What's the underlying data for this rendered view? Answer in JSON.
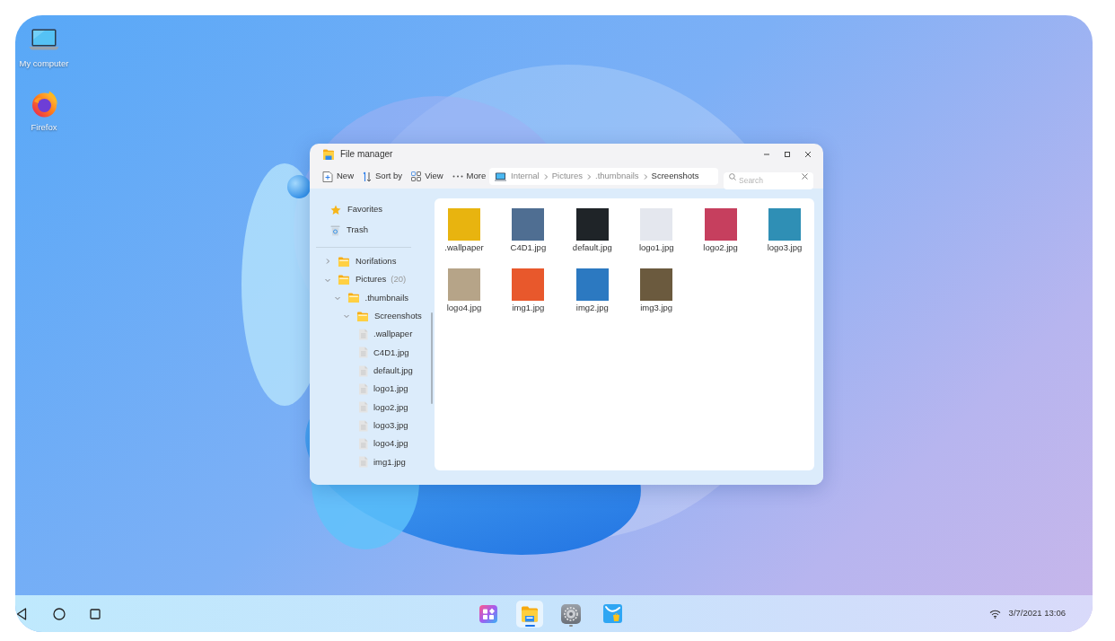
{
  "desktop": {
    "shortcuts": [
      {
        "label": "My computer",
        "kind": "computer"
      },
      {
        "label": "Firefox",
        "kind": "browser"
      }
    ]
  },
  "window": {
    "title": "File manager",
    "toolbar": [
      {
        "label": "New",
        "kind": "new"
      },
      {
        "label": "Sort by",
        "kind": "sort"
      },
      {
        "label": "View",
        "kind": "view"
      },
      {
        "label": "More",
        "kind": "more"
      }
    ],
    "path": [
      {
        "label": "Internal",
        "selected": false
      },
      {
        "label": "Pictures",
        "selected": false
      },
      {
        "label": ".thumbnails",
        "selected": false
      },
      {
        "label": "Screenshots",
        "selected": true
      }
    ],
    "search": {
      "placeholder": "Search"
    },
    "sidebar": {
      "places": [
        {
          "label": "Favorites",
          "kind": "favorites"
        },
        {
          "label": "Trash",
          "kind": "trash"
        }
      ],
      "tree": [
        {
          "label": "Norifations",
          "kind": "folder",
          "expanded": false
        },
        {
          "label": "Pictures",
          "count": "(20)",
          "kind": "folder",
          "expanded": true,
          "children": [
            {
              "label": ".thumbnails",
              "kind": "folder",
              "expanded": true,
              "children": [
                {
                  "label": "Screenshots",
                  "kind": "folder",
                  "expanded": true,
                  "children": [
                    {
                      "label": ".wallpaper",
                      "kind": "file"
                    },
                    {
                      "label": "C4D1.jpg",
                      "kind": "file"
                    },
                    {
                      "label": "default.jpg",
                      "kind": "file"
                    },
                    {
                      "label": "logo1.jpg",
                      "kind": "file"
                    },
                    {
                      "label": "logo2.jpg",
                      "kind": "file"
                    },
                    {
                      "label": "logo3.jpg",
                      "kind": "file"
                    },
                    {
                      "label": "logo4.jpg",
                      "kind": "file"
                    },
                    {
                      "label": "img1.jpg",
                      "kind": "file"
                    }
                  ]
                }
              ]
            }
          ]
        }
      ]
    },
    "files": [
      {
        "name": ".wallpaper"
      },
      {
        "name": "C4D1.jpg"
      },
      {
        "name": "default.jpg"
      },
      {
        "name": "logo1.jpg"
      },
      {
        "name": "logo2.jpg"
      },
      {
        "name": "logo3.jpg"
      },
      {
        "name": "logo4.jpg"
      },
      {
        "name": "img1.jpg"
      },
      {
        "name": "img2.jpg"
      },
      {
        "name": "img3.jpg"
      }
    ]
  },
  "taskbar": {
    "apps": [
      {
        "kind": "launcher",
        "selected": false,
        "running": false
      },
      {
        "kind": "files",
        "selected": true,
        "running": true
      },
      {
        "kind": "settings",
        "selected": false,
        "running": true
      },
      {
        "kind": "store",
        "selected": false,
        "running": false
      }
    ],
    "clock": "3/7/2021 13:06"
  }
}
